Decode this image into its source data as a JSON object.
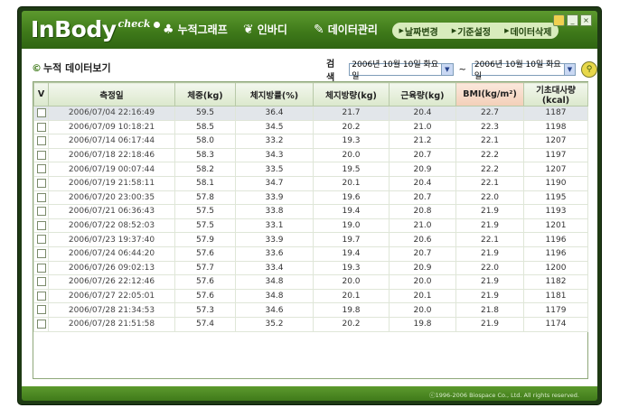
{
  "app": {
    "logo_main": "InBody",
    "logo_sub": "check"
  },
  "menu": [
    {
      "label": "누적그래프",
      "icon": "graph-icon"
    },
    {
      "label": "인바디",
      "icon": "people-icon"
    },
    {
      "label": "데이터관리",
      "icon": "data-icon"
    }
  ],
  "subnav": [
    "날짜변경",
    "기준설정",
    "데이터삭제"
  ],
  "section_title": "누적 데이터보기",
  "search": {
    "label": "검색",
    "from": "2006년 10월 10일 화요일",
    "to": "2006년 10월 10일 화요일",
    "tilde": "~"
  },
  "columns": [
    "V",
    "측정일",
    "체중(kg)",
    "체지방률(%)",
    "체지방량(kg)",
    "근육량(kg)",
    "BMI(kg/m²)",
    "기초대사량(kcal)"
  ],
  "rows": [
    [
      "2006/07/04 22:16:49",
      "59.5",
      "36.4",
      "21.7",
      "20.4",
      "22.7",
      "1187"
    ],
    [
      "2006/07/09 10:18:21",
      "58.5",
      "34.5",
      "20.2",
      "21.0",
      "22.3",
      "1198"
    ],
    [
      "2006/07/14 06:17:44",
      "58.0",
      "33.2",
      "19.3",
      "21.2",
      "22.1",
      "1207"
    ],
    [
      "2006/07/18 22:18:46",
      "58.3",
      "34.3",
      "20.0",
      "20.7",
      "22.2",
      "1197"
    ],
    [
      "2006/07/19 00:07:44",
      "58.2",
      "33.5",
      "19.5",
      "20.9",
      "22.2",
      "1207"
    ],
    [
      "2006/07/19 21:58:11",
      "58.1",
      "34.7",
      "20.1",
      "20.4",
      "22.1",
      "1190"
    ],
    [
      "2006/07/20 23:00:35",
      "57.8",
      "33.9",
      "19.6",
      "20.7",
      "22.0",
      "1195"
    ],
    [
      "2006/07/21 06:36:43",
      "57.5",
      "33.8",
      "19.4",
      "20.8",
      "21.9",
      "1193"
    ],
    [
      "2006/07/22 08:52:03",
      "57.5",
      "33.1",
      "19.0",
      "21.0",
      "21.9",
      "1201"
    ],
    [
      "2006/07/23 19:37:40",
      "57.9",
      "33.9",
      "19.7",
      "20.6",
      "22.1",
      "1196"
    ],
    [
      "2006/07/24 06:44:20",
      "57.6",
      "33.6",
      "19.4",
      "20.7",
      "21.9",
      "1196"
    ],
    [
      "2006/07/26 09:02:13",
      "57.7",
      "33.4",
      "19.3",
      "20.9",
      "22.0",
      "1200"
    ],
    [
      "2006/07/26 22:12:46",
      "57.6",
      "34.8",
      "20.0",
      "20.0",
      "21.9",
      "1182"
    ],
    [
      "2006/07/27 22:05:01",
      "57.6",
      "34.8",
      "20.1",
      "20.1",
      "21.9",
      "1181"
    ],
    [
      "2006/07/28 21:34:53",
      "57.3",
      "34.6",
      "19.8",
      "20.0",
      "21.8",
      "1179"
    ],
    [
      "2006/07/28 21:51:58",
      "57.4",
      "35.2",
      "20.2",
      "19.8",
      "21.9",
      "1174"
    ]
  ],
  "footer": "ⓒ1996-2006 Biospace Co., Ltd. All rights reserved.",
  "colors": {
    "brand": "#3f7a1a",
    "frame": "#1e3a14",
    "bmi_header": "#f3cfb8"
  }
}
